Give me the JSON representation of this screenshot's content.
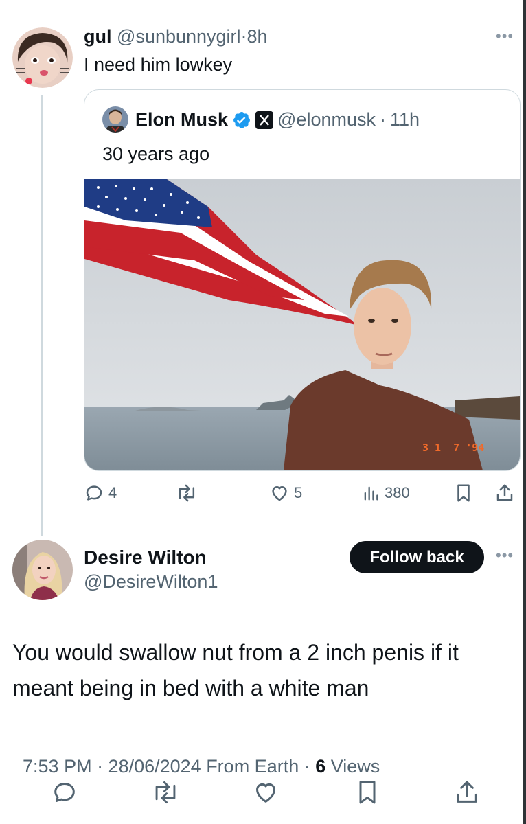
{
  "reply": {
    "display_name": "gul",
    "handle": "@sunbunnygirl",
    "separator": "·",
    "time": "8h",
    "text": "I need him lowkey"
  },
  "quote": {
    "display_name": "Elon Musk",
    "handle": "@elonmusk",
    "separator": "·",
    "time": "11h",
    "text": "30 years ago",
    "photo_date_stamp": "3 1  7 '94"
  },
  "reply_actions": {
    "replies": "4",
    "retweets": "",
    "likes": "5",
    "views": "380"
  },
  "main_tweet": {
    "display_name": "Desire Wilton",
    "handle": "@DesireWilton1",
    "follow_label": "Follow back",
    "text_line1": "You would swallow nut from a 2 inch penis if it",
    "text_line2": "meant being in bed with a white man",
    "timestamp": "7:53 PM · 28/06/2024 From Earth · ",
    "views_count": "6",
    "views_label": " Views"
  },
  "icons": {
    "more": "•••",
    "reply": "reply-icon",
    "retweet": "retweet-icon",
    "like": "heart-icon",
    "views": "views-icon",
    "bookmark": "bookmark-icon",
    "share": "share-icon",
    "verified": "verified-badge-icon",
    "x_logo": "x-logo-icon"
  },
  "colors": {
    "text": "#0f1419",
    "muted": "#536471",
    "verified": "#1d9bf0",
    "border": "#cfd9de"
  }
}
